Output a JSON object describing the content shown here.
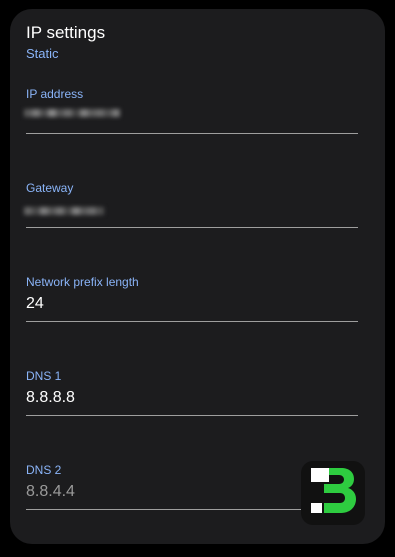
{
  "dialog": {
    "title": "IP settings",
    "subtitle": "Static"
  },
  "fields": {
    "ip_address": {
      "label": "IP address",
      "value": ""
    },
    "gateway": {
      "label": "Gateway",
      "value": ""
    },
    "prefix": {
      "label": "Network prefix length",
      "value": "24"
    },
    "dns1": {
      "label": "DNS 1",
      "value": "8.8.8.8"
    },
    "dns2": {
      "label": "DNS 2",
      "placeholder": "8.8.4.4"
    }
  },
  "colors": {
    "accent": "#8ab4f8",
    "background": "#1c1c1e",
    "badge_green": "#2ecc40"
  },
  "badge_icon": "b-logo-icon"
}
